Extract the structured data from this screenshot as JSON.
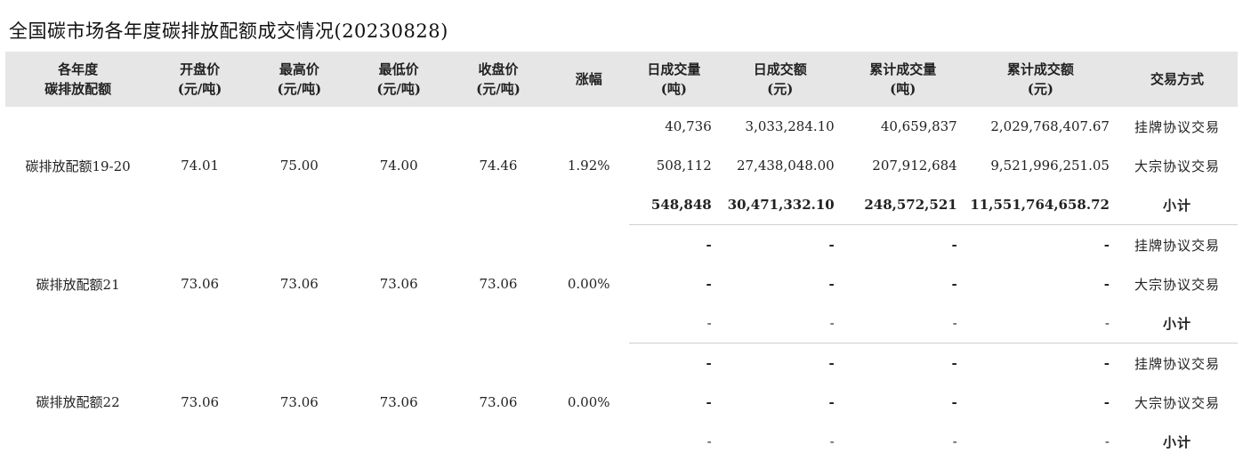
{
  "title": "全国碳市场各年度碳排放配额成交情况(20230828)",
  "headers": [
    [
      "各年度",
      "碳排放配额"
    ],
    [
      "开盘价",
      "(元/吨)"
    ],
    [
      "最高价",
      "(元/吨)"
    ],
    [
      "最低价",
      "(元/吨)"
    ],
    [
      "收盘价",
      "(元/吨)"
    ],
    [
      "涨幅",
      ""
    ],
    [
      "日成交量",
      "(吨)"
    ],
    [
      "日成交额",
      "(元)"
    ],
    [
      "累计成交量",
      "(吨)"
    ],
    [
      "累计成交额",
      "(元)"
    ],
    [
      "交易方式",
      ""
    ]
  ],
  "groups": [
    {
      "name": "碳排放配额19-20",
      "open": "74.01",
      "high": "75.00",
      "low": "74.00",
      "close": "74.46",
      "change": "1.92%",
      "rows": [
        {
          "daily_volume": "40,736",
          "daily_amount": "3,033,284.10",
          "cum_volume": "40,659,837",
          "cum_amount": "2,029,768,407.67",
          "method": "挂牌协议交易"
        },
        {
          "daily_volume": "508,112",
          "daily_amount": "27,438,048.00",
          "cum_volume": "207,912,684",
          "cum_amount": "9,521,996,251.05",
          "method": "大宗协议交易"
        },
        {
          "daily_volume": "548,848",
          "daily_amount": "30,471,332.10",
          "cum_volume": "248,572,521",
          "cum_amount": "11,551,764,658.72",
          "method": "小计"
        }
      ]
    },
    {
      "name": "碳排放配额21",
      "open": "73.06",
      "high": "73.06",
      "low": "73.06",
      "close": "73.06",
      "change": "0.00%",
      "rows": [
        {
          "daily_volume": "-",
          "daily_amount": "-",
          "cum_volume": "-",
          "cum_amount": "-",
          "method": "挂牌协议交易"
        },
        {
          "daily_volume": "-",
          "daily_amount": "-",
          "cum_volume": "-",
          "cum_amount": "-",
          "method": "大宗协议交易"
        },
        {
          "daily_volume": "-",
          "daily_amount": "-",
          "cum_volume": "-",
          "cum_amount": "-",
          "method": "小计"
        }
      ]
    },
    {
      "name": "碳排放配额22",
      "open": "73.06",
      "high": "73.06",
      "low": "73.06",
      "close": "73.06",
      "change": "0.00%",
      "rows": [
        {
          "daily_volume": "-",
          "daily_amount": "-",
          "cum_volume": "-",
          "cum_amount": "-",
          "method": "挂牌协议交易"
        },
        {
          "daily_volume": "-",
          "daily_amount": "-",
          "cum_volume": "-",
          "cum_amount": "-",
          "method": "大宗协议交易"
        },
        {
          "daily_volume": "-",
          "daily_amount": "-",
          "cum_volume": "-",
          "cum_amount": "-",
          "method": "小计"
        }
      ]
    }
  ]
}
